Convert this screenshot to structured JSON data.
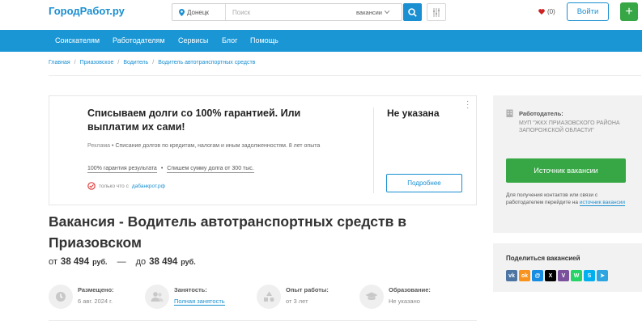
{
  "header": {
    "logo": "ГородРабот.ру",
    "city": "Донецк",
    "search_placeholder": "Поиск",
    "search_type": "вакансии",
    "favorites_count": "(0)",
    "login_label": "Войти",
    "plus_label": "+"
  },
  "nav": {
    "items": [
      "Соискателям",
      "Работодателям",
      "Сервисы",
      "Блог",
      "Помощь"
    ]
  },
  "breadcrumb": [
    "Главная",
    "Приазовское",
    "Водитель",
    "Водитель автотранспортных средств"
  ],
  "ad": {
    "title": "Списываем долги со 100% гарантией. Или выплатим их сами!",
    "tag": "Реклама",
    "description": "Списание долгов по кредитам, налогам и иным задолженностям. 8 лет опыта",
    "link1": "100% гарантия результата",
    "link2": "Спишем сумму долга от 300 тыс.",
    "source_prefix": "только что с",
    "source_domain": "дабанкрот.рф",
    "price": "Не указана",
    "more_label": "Подробнее"
  },
  "vacancy": {
    "title": "Вакансия - Водитель автотранспортных средств в Приазовском",
    "salary_from_prefix": "от",
    "salary_from": "38 494",
    "salary_to_prefix": "до",
    "salary_to": "38 494",
    "currency": "руб.",
    "dash": "—",
    "facts": [
      {
        "label": "Размещено:",
        "value": "6 авг. 2024 г."
      },
      {
        "label": "Занятость:",
        "value": "Полная занятость"
      },
      {
        "label": "Опыт работы:",
        "value": "от 3 лет"
      },
      {
        "label": "Образование:",
        "value": "Не указано"
      }
    ]
  },
  "sidebar": {
    "employer_label": "Работодатель:",
    "employer_name": "МУП \"ЖКХ ПРИАЗОВСКОГО РАЙОНА ЗАПОРОЖСКОЙ ОБЛАСТИ\"",
    "source_button": "Источник вакансии",
    "contact_note": "Для получения контактов или связи с работодателем перейдите на",
    "contact_link": "источник вакансии",
    "share_label": "Поделиться вакансией"
  },
  "colors": {
    "brand": "#1a8fd1",
    "nav_bg": "#1a96d4",
    "green": "#37a745",
    "sidebar_bg": "#f2f2f2"
  },
  "share_icons": [
    "vk-icon",
    "ok-icon",
    "moimir-icon",
    "x-icon",
    "viber-icon",
    "whatsapp-icon",
    "skype-icon",
    "telegram-icon"
  ]
}
